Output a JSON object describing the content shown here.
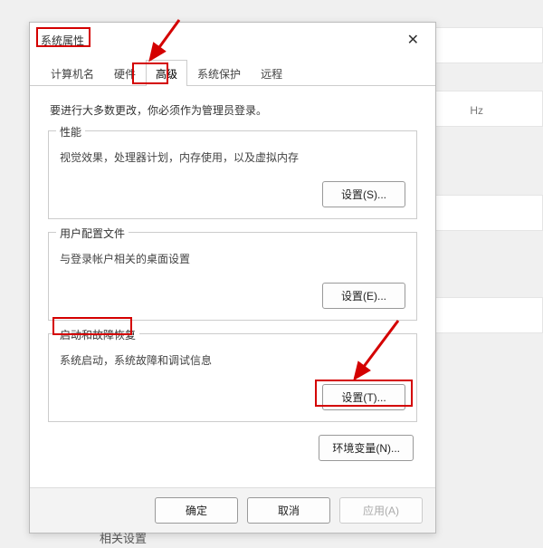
{
  "dialog": {
    "title": "系统属性",
    "tabs": {
      "computer_name": "计算机名",
      "hardware": "硬件",
      "advanced": "高级",
      "system_protection": "系统保护",
      "remote": "远程"
    },
    "admin_note": "要进行大多数更改，你必须作为管理员登录。",
    "groups": {
      "performance": {
        "caption": "性能",
        "desc": "视觉效果，处理器计划，内存使用，以及虚拟内存",
        "btn": "设置(S)..."
      },
      "profiles": {
        "caption": "用户配置文件",
        "desc": "与登录帐户相关的桌面设置",
        "btn": "设置(E)..."
      },
      "startup": {
        "caption": "启动和故障恢复",
        "desc": "系统启动，系统故障和调试信息",
        "btn": "设置(T)..."
      }
    },
    "env_btn": "环境变量(N)...",
    "bottom": {
      "ok": "确定",
      "cancel": "取消",
      "apply": "应用(A)"
    }
  },
  "bg": {
    "hz": "Hz",
    "related": "相关设置"
  }
}
